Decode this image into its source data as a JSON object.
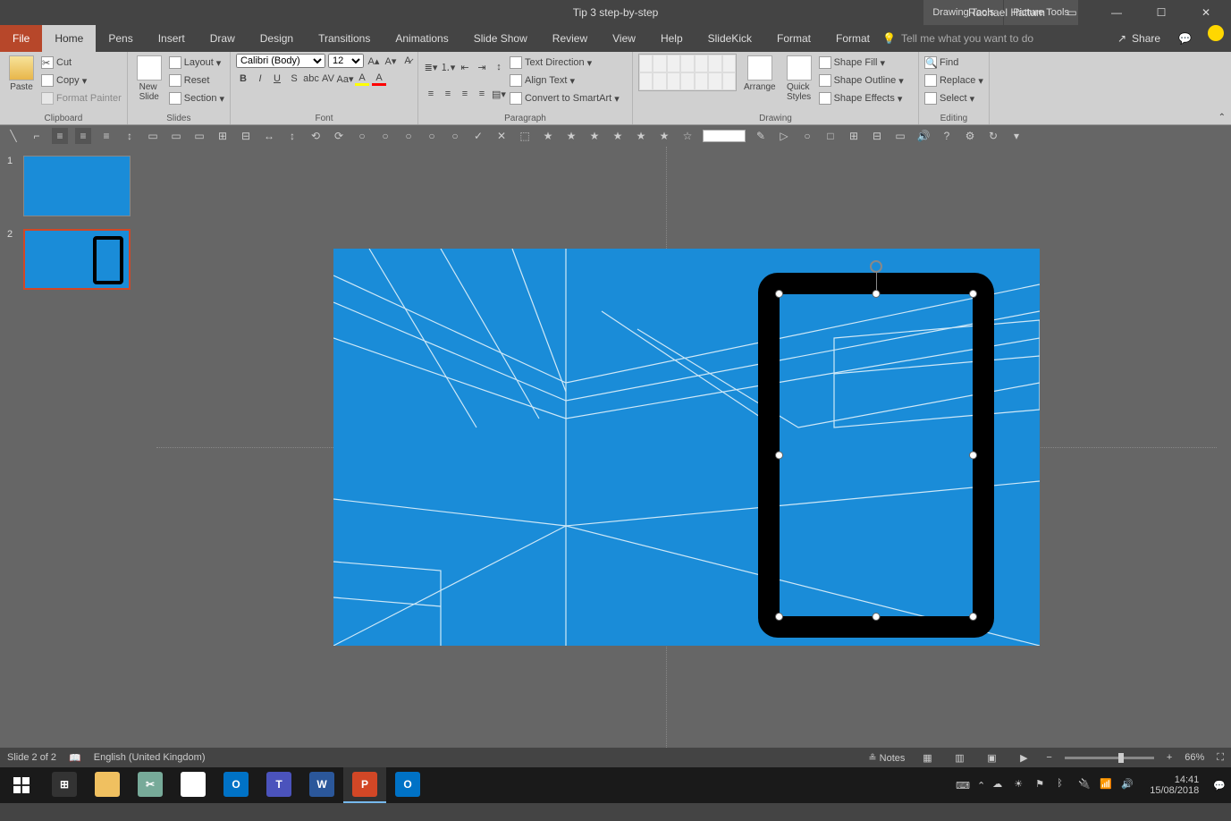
{
  "title": "Tip 3 step-by-step",
  "contextTools": [
    "Drawing Tools",
    "Picture Tools"
  ],
  "user": "Rachael Hattam",
  "tabs": {
    "file": "File",
    "list": [
      "Home",
      "Pens",
      "Insert",
      "Draw",
      "Design",
      "Transitions",
      "Animations",
      "Slide Show",
      "Review",
      "View",
      "Help",
      "SlideKick",
      "Format",
      "Format"
    ],
    "active": "Home",
    "tell": "Tell me what you want to do",
    "share": "Share"
  },
  "ribbon": {
    "clipboard": {
      "label": "Clipboard",
      "paste": "Paste",
      "cut": "Cut",
      "copy": "Copy",
      "fp": "Format Painter"
    },
    "slides": {
      "label": "Slides",
      "new": "New\nSlide",
      "layout": "Layout",
      "reset": "Reset",
      "section": "Section"
    },
    "font": {
      "label": "Font",
      "name": "Calibri (Body)",
      "size": "12"
    },
    "paragraph": {
      "label": "Paragraph",
      "textdir": "Text Direction",
      "align": "Align Text",
      "smart": "Convert to SmartArt"
    },
    "drawing": {
      "label": "Drawing",
      "arrange": "Arrange",
      "quick": "Quick\nStyles",
      "fill": "Shape Fill",
      "outline": "Shape Outline",
      "effects": "Shape Effects"
    },
    "editing": {
      "label": "Editing",
      "find": "Find",
      "replace": "Replace",
      "select": "Select"
    }
  },
  "thumbs": [
    {
      "num": "1",
      "selected": false,
      "hasFrame": false
    },
    {
      "num": "2",
      "selected": true,
      "hasFrame": true
    }
  ],
  "status": {
    "slide": "Slide 2 of 2",
    "lang": "English (United Kingdom)",
    "notes": "Notes",
    "zoom": "66%"
  },
  "taskbar": {
    "apps": [
      {
        "name": "explorer",
        "color": "#f0c060",
        "label": ""
      },
      {
        "name": "snip",
        "color": "#7a9",
        "label": "✂"
      },
      {
        "name": "chrome",
        "color": "#fff",
        "label": "◉"
      },
      {
        "name": "outlook",
        "color": "#0072c6",
        "label": "O"
      },
      {
        "name": "teams",
        "color": "#4b53bc",
        "label": "T"
      },
      {
        "name": "word",
        "color": "#2b579a",
        "label": "W"
      },
      {
        "name": "powerpoint",
        "color": "#d24726",
        "label": "P",
        "active": true
      },
      {
        "name": "outlook2",
        "color": "#0072c6",
        "label": "O"
      }
    ],
    "time": "14:41",
    "date": "15/08/2018"
  }
}
